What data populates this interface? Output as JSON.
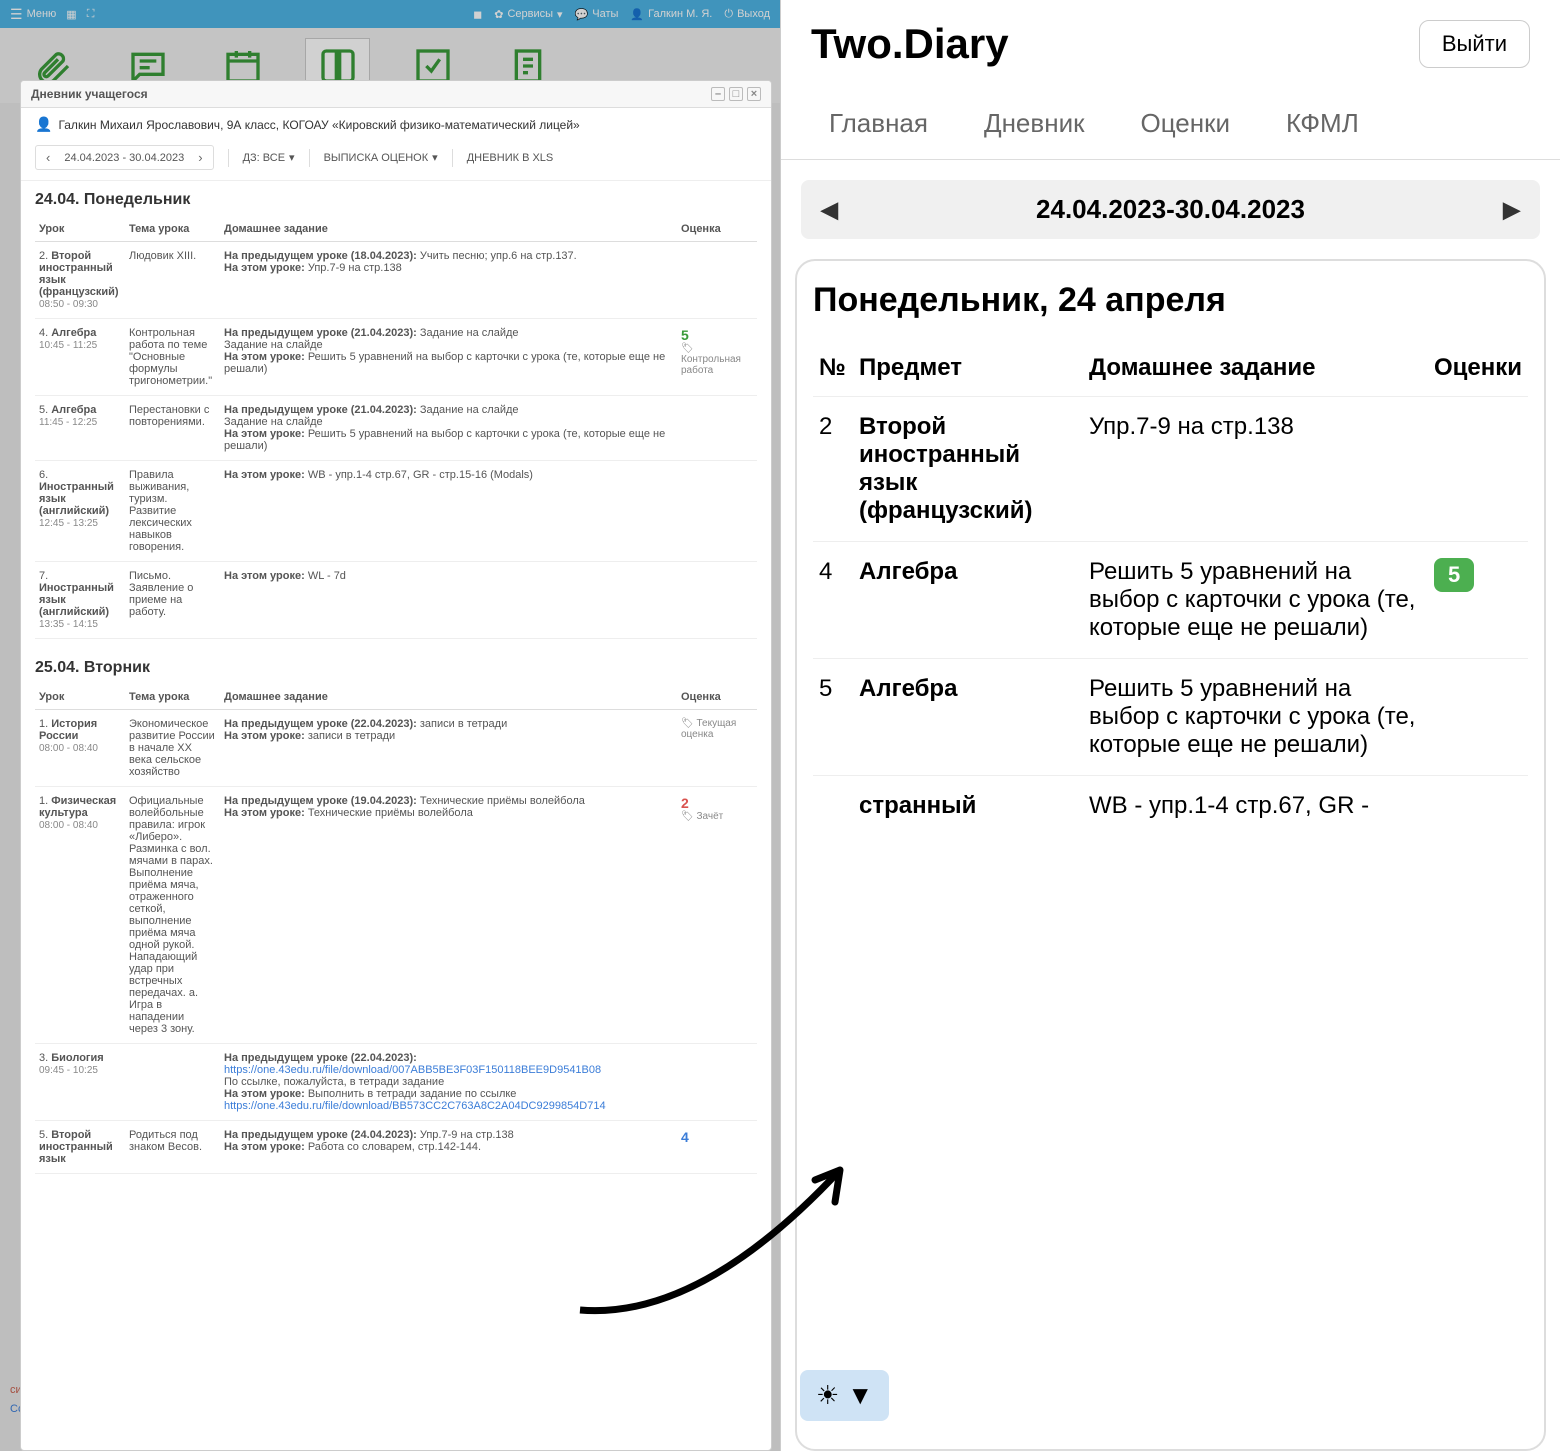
{
  "left": {
    "topbar": {
      "menu": "Меню",
      "services": "Сервисы",
      "chats": "Чаты",
      "user": "Галкин М. Я.",
      "logout": "Выход"
    },
    "dialog_title": "Дневник учащегося",
    "student_info": "Галкин Михаил Ярославович, 9А класс, КОГОАУ «Кировский физико-математический лицей»",
    "date_range": "24.04.2023 - 30.04.2023",
    "toolbar": {
      "hw_filter": "ДЗ: ВСЕ",
      "export": "ВЫПИСКА ОЦЕНОК",
      "xls": "ДНЕВНИК В XLS"
    },
    "columns": {
      "lesson": "Урок",
      "topic": "Тема урока",
      "hw": "Домашнее задание",
      "grade": "Оценка"
    },
    "hw_prev_prefix": "На предыдущем уроке",
    "hw_curr_prefix": "На этом уроке:",
    "days": [
      {
        "title": "24.04. Понедельник",
        "rows": [
          {
            "num": "2",
            "subj": "Второй иностранный язык (французский)",
            "time": "08:50 - 09:30",
            "topic": "Людовик XIII.",
            "prev_date": "(18.04.2023):",
            "prev": "Учить песню; упр.6 на стр.137.",
            "curr": "Упр.7-9 на стр.138",
            "grade": "",
            "gcls": "",
            "gtype": ""
          },
          {
            "num": "4",
            "subj": "Алгебра",
            "time": "10:45 - 11:25",
            "topic": "Контрольная работа по теме \"Основные формулы тригонометрии.\"",
            "prev_date": "(21.04.2023):",
            "prev": "Задание на слайде\nЗадание на слайде",
            "curr": "Решить 5 уравнений на выбор с карточки с урока (те, которые еще не решали)",
            "grade": "5",
            "gcls": "grade-5",
            "gtype": "Контрольная работа"
          },
          {
            "num": "5",
            "subj": "Алгебра",
            "time": "11:45 - 12:25",
            "topic": "Перестановки с повторениями.",
            "prev_date": "(21.04.2023):",
            "prev": "Задание на слайде\nЗадание на слайде",
            "curr": "Решить 5 уравнений на выбор с карточки с урока (те, которые еще не решали)",
            "grade": "",
            "gcls": "",
            "gtype": ""
          },
          {
            "num": "6",
            "subj": "Иностранный язык (английский)",
            "time": "12:45 - 13:25",
            "topic": "Правила выживания, туризм. Развитие лексических навыков говорения.",
            "prev_date": "",
            "prev": "",
            "curr": "WB - упр.1-4 стр.67, GR - стр.15-16 (Modals)",
            "grade": "",
            "gcls": "",
            "gtype": ""
          },
          {
            "num": "7",
            "subj": "Иностранный язык (английский)",
            "time": "13:35 - 14:15",
            "topic": "Письмо. Заявление о приеме на работу.",
            "prev_date": "",
            "prev": "",
            "curr": "WL - 7d",
            "grade": "",
            "gcls": "",
            "gtype": ""
          }
        ]
      },
      {
        "title": "25.04. Вторник",
        "rows": [
          {
            "num": "1",
            "subj": "История России",
            "time": "08:00 - 08:40",
            "topic": "Экономическое развитие России в начале XX века сельское хозяйство",
            "prev_date": "(22.04.2023):",
            "prev": "записи в тетради",
            "curr": "записи в тетради",
            "grade": "",
            "gcls": "",
            "gtype": "Текущая оценка"
          },
          {
            "num": "1",
            "subj": "Физическая культура",
            "time": "08:00 - 08:40",
            "topic": "Официальные волейбольные правила: игрок «Либеро». Разминка с вол. мячами в парах. Выполнение приёма мяча, отраженного сеткой, выполнение приёма мяча одной рукой. Нападающий удар при встречных передачах. а. Игра в нападении через 3 зону.",
            "prev_date": "(19.04.2023):",
            "prev": "Технические приёмы волейбола",
            "curr": "Технические приёмы волейбола",
            "grade": "2",
            "gcls": "grade-2",
            "gtype": "Зачёт"
          },
          {
            "num": "3",
            "subj": "Биология",
            "time": "09:45 - 10:25",
            "topic": "",
            "prev_date": "(22.04.2023):",
            "prev": "",
            "curr": "Выполнить в тетради задание по ссылке",
            "link1": "https://one.43edu.ru/file/download/007ABB5BE3F03F150118BEE9D9541B08",
            "link1_note": "По ссылке, пожалуйста, в тетради задание",
            "link2": "https://one.43edu.ru/file/download/BB573CC2C763A8C2A04DC9299854D714",
            "grade": "",
            "gcls": "",
            "gtype": ""
          },
          {
            "num": "5",
            "subj": "Второй иностранный язык",
            "time": "",
            "topic": "Родиться под знаком Весов.",
            "prev_date": "(24.04.2023):",
            "prev": "Упр.7-9 на стр.138",
            "curr": "Работа со словарем, стр.142-144.",
            "grade": "4",
            "gcls": "grade-4",
            "gtype": ""
          }
        ]
      }
    ],
    "bg_hints": [
      "системой Android.",
      "Ссылка на приложение"
    ]
  },
  "right": {
    "app_title": "Two.Diary",
    "logout": "Выйти",
    "tabs": [
      "Главная",
      "Дневник",
      "Оценки",
      "КФМЛ"
    ],
    "date_range": "24.04.2023-30.04.2023",
    "day_title": "Понедельник, 24 апреля",
    "columns": {
      "num": "№",
      "subj": "Предмет",
      "hw": "Домашнее задание",
      "grade": "Оценки"
    },
    "rows": [
      {
        "num": "2",
        "subj": "Второй иностранный язык (французский)",
        "hw": "Упр.7-9 на стр.138",
        "grade": ""
      },
      {
        "num": "4",
        "subj": "Алгебра",
        "hw": "Решить 5 уравнений на выбор с карточки с урока (те, которые еще не решали)",
        "grade": "5"
      },
      {
        "num": "5",
        "subj": "Алгебра",
        "hw": "Решить 5 уравнений на выбор с карточки с урока (те, которые еще не решали)",
        "grade": ""
      },
      {
        "num": "",
        "subj": "странный",
        "subj2": "",
        "hw": "WB - упр.1-4 стр.67, GR -",
        "grade": ""
      }
    ]
  }
}
